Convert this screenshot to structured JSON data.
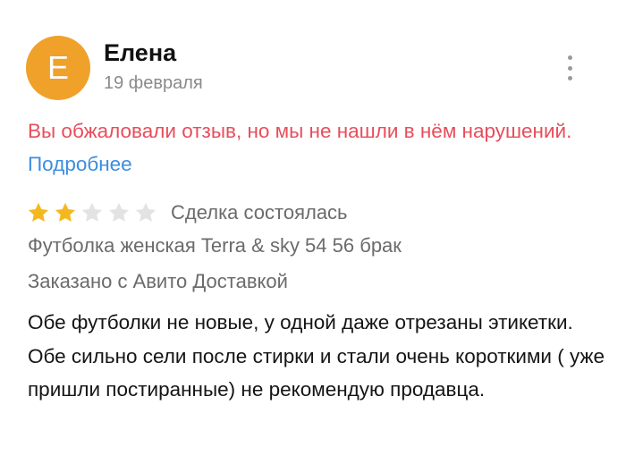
{
  "review": {
    "author": {
      "initial": "Е",
      "name": "Елена",
      "date": "19 февраля",
      "avatar_color": "#f0a12a"
    },
    "menu_icon": "more-vertical-icon",
    "moderation_notice": {
      "text": "Вы обжаловали отзыв, но мы не нашли в нём нарушений.",
      "link": "Подробнее",
      "text_color": "#e84d5b",
      "link_color": "#3b8ee0"
    },
    "rating": {
      "value": 2,
      "max": 5,
      "filled_color": "#f4b81f",
      "empty_color": "#e3e3e3"
    },
    "deal_status": "Сделка состоялась",
    "product": "Футболка женская Terra & sky 54 56 брак",
    "delivery": "Заказано с Авито Доставкой",
    "text": "Обе футболки не новые, у одной даже отрезаны этикетки. Обе сильно сели после стирки и стали очень короткими ( уже пришли постиранные) не рекомендую продавца."
  }
}
